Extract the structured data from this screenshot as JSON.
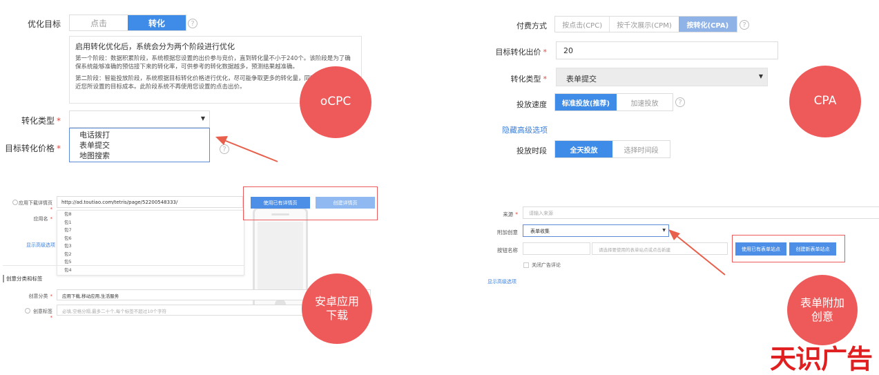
{
  "ocpc": {
    "goal_label": "优化目标",
    "goal_options": [
      "点击",
      "转化"
    ],
    "info_title": "启用转化优化后，系统会分为两个阶段进行优化",
    "info_p1": "第一个阶段：数据积累阶段，系统根据您设置的出价参与竞价，直到转化量不小于240个。该阶段是为了确保系统能够准确的预估接下来的转化率，可供参考的转化数据越多，预测结果越准确。",
    "info_p2": "第二阶段：智能投放阶段，系统根据目标转化价格进行优化，尽可能争取更多的转化量，同时使转化成本接近您所设置的目标成本。此阶段系统不再使用您设置的点击出价。",
    "conv_type_label": "转化类型",
    "target_price_label": "目标转化价格",
    "dropdown_options": [
      "电话拨打",
      "表单提交",
      "地图搜索"
    ],
    "circle_label": "oCPC"
  },
  "cpa": {
    "pay_label": "付费方式",
    "pay_options": [
      "按点击(CPC)",
      "按千次展示(CPM)",
      "按转化(CPA)"
    ],
    "bid_label": "目标转化出价",
    "bid_value": "20",
    "conv_type_label": "转化类型",
    "conv_type_value": "表单提交",
    "speed_label": "投放速度",
    "speed_options": [
      "标准投放(推荐)",
      "加速投放"
    ],
    "advanced_link": "隐藏高级选项",
    "period_label": "投放时段",
    "period_options": [
      "全天投放",
      "选择时间段"
    ],
    "circle_label": "CPA"
  },
  "android": {
    "url_label": "应用下载详情页",
    "url_value": "http://ad.toutiao.com/tetris/page/52200548333/",
    "app_name_label": "应用名",
    "packages": [
      "包8",
      "包1",
      "包7",
      "包6",
      "包3",
      "包2",
      "包5",
      "包4"
    ],
    "advanced_link": "显示高级选项",
    "btn_existing": "使用已有详情页",
    "btn_create": "创建详情页",
    "section_title": "创意分类和标签",
    "category_label": "创意分类",
    "category_value": "应用下载,移动应用,生活服务",
    "tags_label": "创意标签",
    "tags_placeholder": "必填,空格分隔,最多二十个,每个标签不超过10个字符",
    "circle_label_1": "安卓应用",
    "circle_label_2": "下载"
  },
  "form": {
    "source_label": "来源",
    "source_placeholder": "请输入来源",
    "attach_label": "附加创意",
    "attach_value": "表单收集",
    "button_name_label": "按钮名称",
    "button_name_placeholder": "请选择要使用的表单站点或点击新建",
    "btn_existing": "使用已有表单站点",
    "btn_create": "创建新表单站点",
    "close_comment": "关闭广告评论",
    "advanced_link": "显示高级选项",
    "circle_label_1": "表单附加",
    "circle_label_2": "创意"
  },
  "brand": {
    "logo_text": "天识广告"
  },
  "colors": {
    "accent": "#3f8be8",
    "circle": "#ee5a5a",
    "arrow": "#e8604c",
    "logo": "#e02020"
  }
}
